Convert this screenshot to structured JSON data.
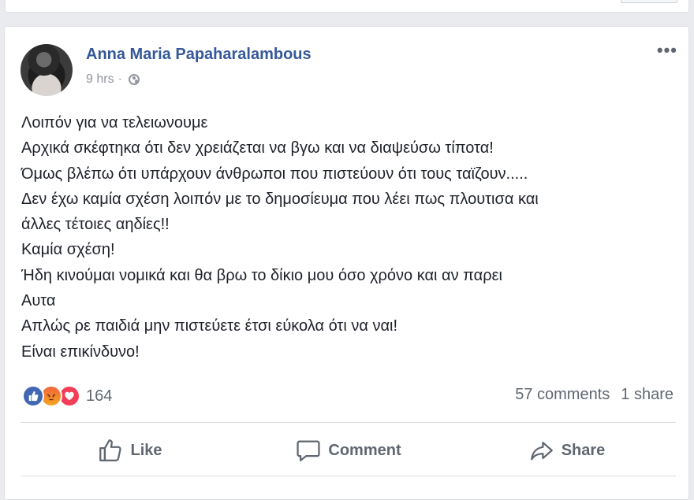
{
  "post": {
    "author": "Anna Maria Papaharalambous",
    "time": "9 hrs",
    "separator": "·",
    "privacy_icon": "globe-icon",
    "more_label": "•••",
    "lines": [
      "Λοιπόν για να τελειωνουμε",
      "Αρχικά σκέφτηκα ότι δεν χρειάζεται να βγω και να διαψεύσω τίποτα!",
      "Όμως βλέπω ότι υπάρχουν άνθρωποι που πιστεύουν ότι τους ταϊζουν.....",
      "Δεν έχω καμία σχέση λοιπόν με το δημοσίευμα που λέει πως πλουτισα και",
      "άλλες τέτοιες αηδίες!!",
      "Καμία σχέση!",
      "Ήδη κινούμαι νομικά και θα βρω το δίκιο μου όσο χρόνο και αν παρει",
      "Αυτα",
      "Απλώς ρε παιδιά μην πιστεύετε έτσι εύκολα ότι να ναι!",
      "Είναι επικίνδυνο!"
    ]
  },
  "reactions": {
    "icons": [
      "like-reaction-icon",
      "angry-reaction-icon",
      "love-reaction-icon"
    ],
    "count": "164",
    "comments": "57 comments",
    "shares": "1 share"
  },
  "actions": {
    "like": "Like",
    "comment": "Comment",
    "share": "Share"
  },
  "colors": {
    "background": "#e9ebee",
    "author_link": "#365899",
    "secondary_text": "#606770",
    "like_blue": "#4267b2",
    "love_red": "#f33e58"
  }
}
